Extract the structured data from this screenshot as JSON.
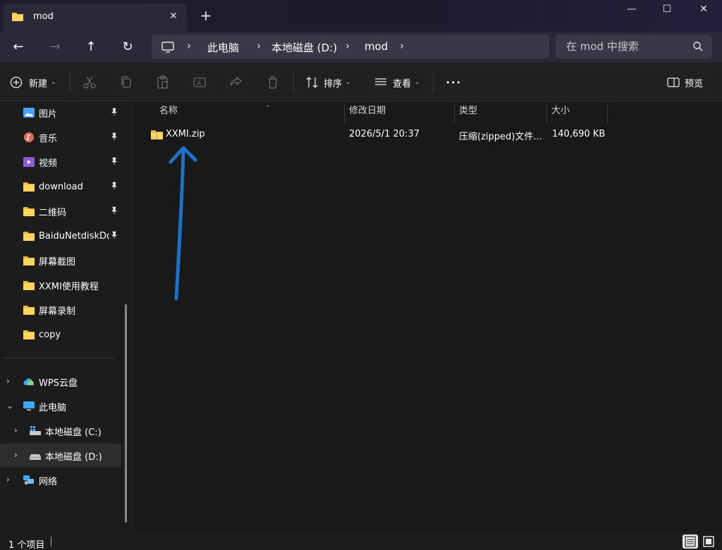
{
  "window": {
    "tab_title": "mod",
    "new_tab": "+",
    "tab_close": "✕",
    "minimize": "—",
    "maximize": "☐",
    "close": "✕"
  },
  "nav": {
    "back": "←",
    "forward": "→",
    "up": "↑",
    "refresh": "↻",
    "breadcrumbs": [
      "此电脑",
      "本地磁盘 (D:)",
      "mod"
    ],
    "separator": "›",
    "search_placeholder": "在 mod 中搜索"
  },
  "toolbar": {
    "new_label": "新建",
    "sort_label": "排序",
    "view_label": "查看",
    "more_label": "•••",
    "preview_label": "预览"
  },
  "sidebar": {
    "quick_access": [
      {
        "label": "图片",
        "icon": "pictures-icon",
        "pinned": true
      },
      {
        "label": "音乐",
        "icon": "music-icon",
        "pinned": true
      },
      {
        "label": "视频",
        "icon": "videos-icon",
        "pinned": true
      },
      {
        "label": "download",
        "icon": "folder-icon",
        "pinned": true
      },
      {
        "label": "二维码",
        "icon": "folder-icon",
        "pinned": true
      },
      {
        "label": "BaiduNetdiskDownload",
        "icon": "folder-icon",
        "pinned": true
      },
      {
        "label": "屏幕截图",
        "icon": "folder-icon",
        "pinned": false
      },
      {
        "label": "XXMI使用教程",
        "icon": "folder-icon",
        "pinned": false
      },
      {
        "label": "屏幕录制",
        "icon": "folder-icon",
        "pinned": false
      },
      {
        "label": "copy",
        "icon": "folder-icon",
        "pinned": false
      }
    ],
    "tree": [
      {
        "label": "WPS云盘",
        "icon": "cloud-icon",
        "expanded": false,
        "selected": false
      },
      {
        "label": "此电脑",
        "icon": "computer-icon",
        "expanded": true,
        "selected": false
      },
      {
        "label": "本地磁盘 (C:)",
        "icon": "drive-icon",
        "expanded": false,
        "selected": false
      },
      {
        "label": "本地磁盘 (D:)",
        "icon": "drive-icon",
        "expanded": false,
        "selected": true
      },
      {
        "label": "网络",
        "icon": "network-icon",
        "expanded": false,
        "selected": false
      }
    ]
  },
  "columns": {
    "name": "名称",
    "modified": "修改日期",
    "type": "类型",
    "size": "大小"
  },
  "files": [
    {
      "name": "XXMI.zip",
      "modified": "2026/5/1 20:37",
      "type": "压缩(zipped)文件...",
      "size": "140,690 KB",
      "icon": "zip-folder-icon"
    }
  ],
  "status": {
    "count": "1 个项目"
  },
  "colors": {
    "annotation_arrow": "#1a73c8",
    "folder": "#f4c24b",
    "accent": "#4cc2ff"
  }
}
